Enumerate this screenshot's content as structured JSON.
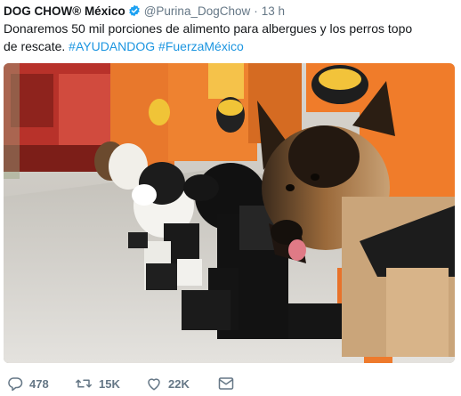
{
  "tweet": {
    "display_name": "DOG CHOW® México",
    "handle": "@Purina_DogChow",
    "separator": "·",
    "time": "13 h",
    "text_line1": "Donaremos 50 mil porciones de alimento para albergues y los perros topo",
    "text_line2": "de rescate.",
    "hashtags": [
      "#AYUDANDOG",
      "#FuerzaMéxico"
    ]
  },
  "media": {
    "description_icon": "photo"
  },
  "actions": {
    "reply_count": "478",
    "retweet_count": "15K",
    "like_count": "22K"
  },
  "colors": {
    "link": "#1b95e0",
    "muted": "#657786",
    "verified": "#1da1f2",
    "rescue_orange": "#f07c2a"
  }
}
